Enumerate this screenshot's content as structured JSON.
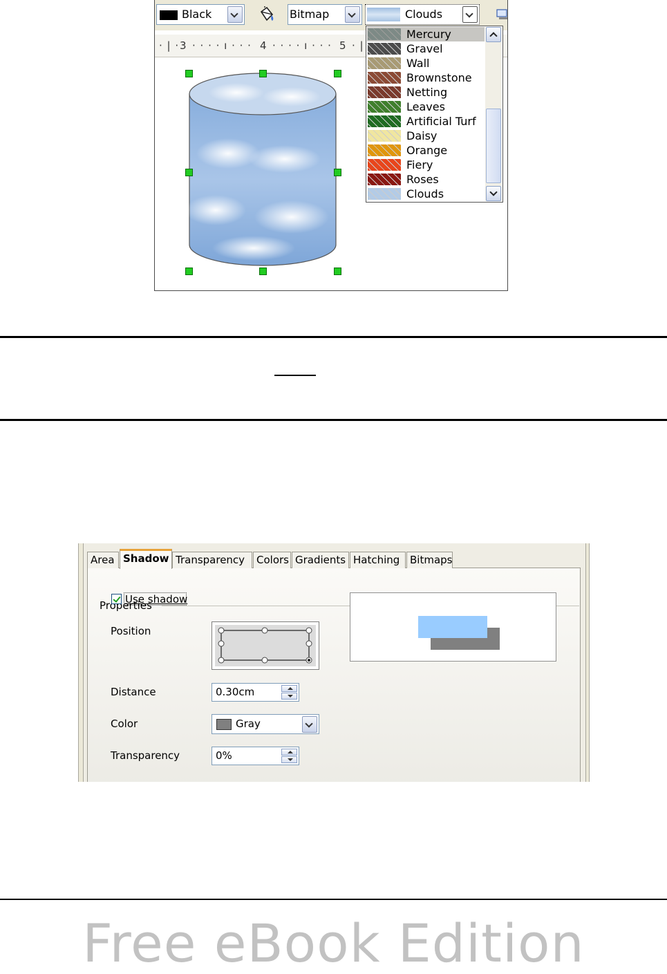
{
  "toolbar": {
    "line_color": "Black",
    "area_style": "Bitmap",
    "bitmap_selected": "Clouds"
  },
  "ruler": {
    "ticks": [
      "3",
      "4",
      "5"
    ]
  },
  "bitmap_list": {
    "items": [
      {
        "label": "Mercury",
        "color": "#7d8a86",
        "selected": true
      },
      {
        "label": "Gravel",
        "color": "#4c4c4c"
      },
      {
        "label": "Wall",
        "color": "#a89a74"
      },
      {
        "label": "Brownstone",
        "color": "#8b4a35"
      },
      {
        "label": "Netting",
        "color": "#7a3a2c"
      },
      {
        "label": "Leaves",
        "color": "#3f7f2c"
      },
      {
        "label": "Artificial Turf",
        "color": "#1f6b22"
      },
      {
        "label": "Daisy",
        "color": "#f0e6a0"
      },
      {
        "label": "Orange",
        "color": "#e0960c"
      },
      {
        "label": "Fiery",
        "color": "#e8451c"
      },
      {
        "label": "Roses",
        "color": "#8a1812"
      },
      {
        "label": "Clouds",
        "color": "#b3cbe6"
      }
    ]
  },
  "dialog": {
    "tabs": [
      {
        "label": "Area"
      },
      {
        "label": "Shadow",
        "active": true
      },
      {
        "label": "Transparency"
      },
      {
        "label": "Colors"
      },
      {
        "label": "Gradients"
      },
      {
        "label": "Hatching"
      },
      {
        "label": "Bitmaps"
      }
    ],
    "section_title": "Properties",
    "use_shadow_label": "Use shadow",
    "use_shadow_checked": true,
    "position_label": "Position",
    "distance_label": "Distance",
    "distance_value": "0.30cm",
    "color_label": "Color",
    "color_value": "Gray",
    "transparency_label": "Transparency",
    "transparency_value": "0%"
  },
  "footer": {
    "text": "Free eBook Edition"
  }
}
